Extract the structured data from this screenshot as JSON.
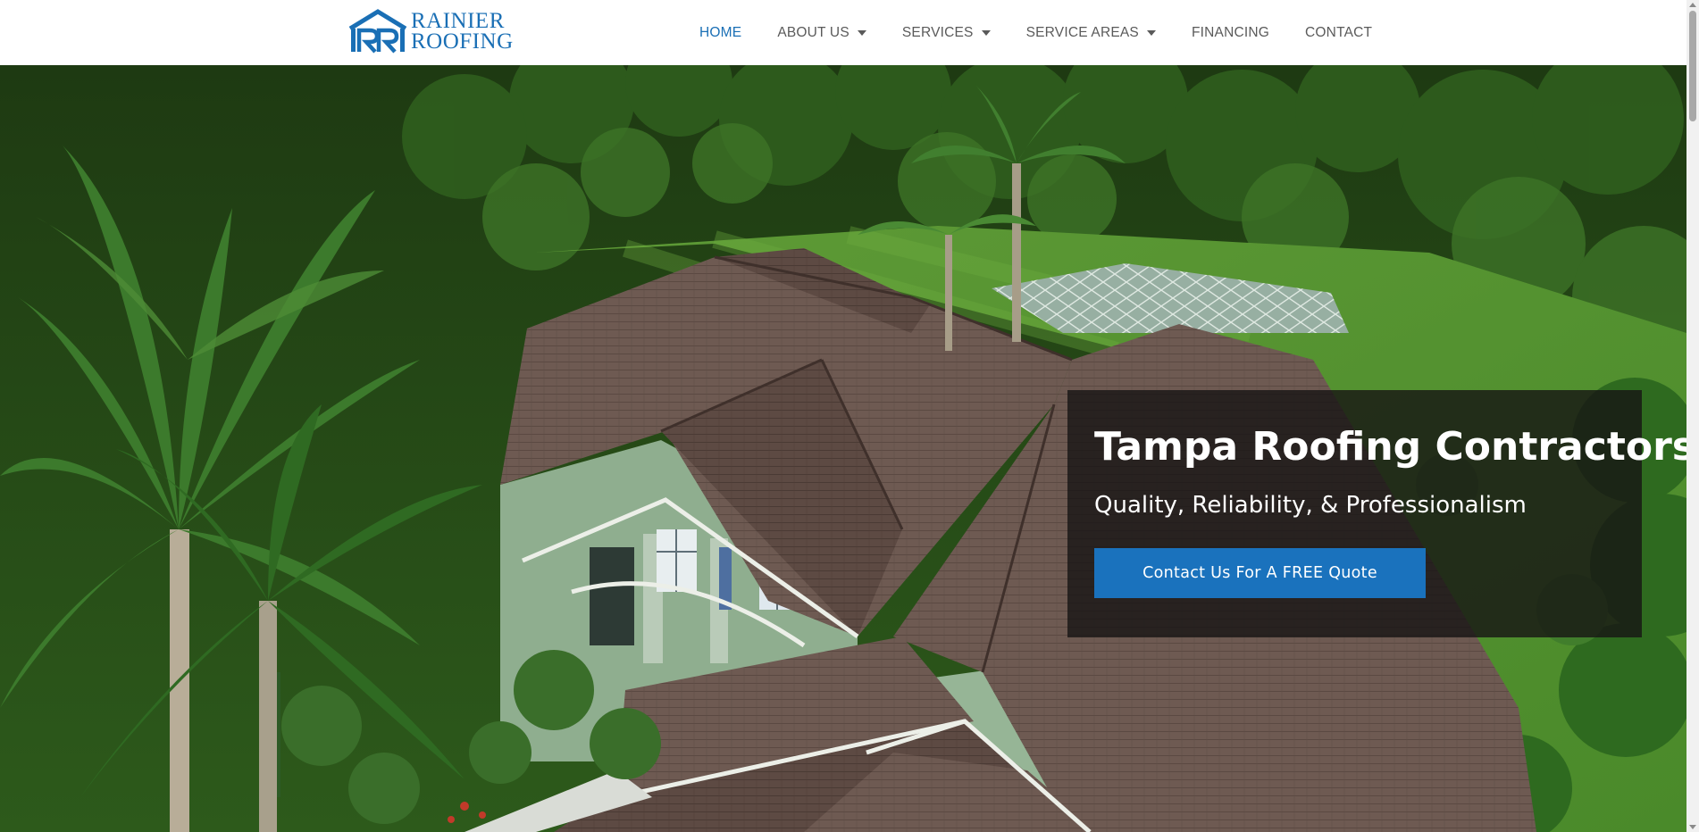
{
  "brand": {
    "logo_line1": "RAINIER",
    "logo_line2": "ROOFING",
    "logo_color": "#1a6fb5"
  },
  "nav": {
    "items": [
      {
        "label": "HOME",
        "active": true,
        "has_dropdown": false
      },
      {
        "label": "ABOUT US",
        "active": false,
        "has_dropdown": true
      },
      {
        "label": "SERVICES",
        "active": false,
        "has_dropdown": true
      },
      {
        "label": "SERVICE AREAS",
        "active": false,
        "has_dropdown": true
      },
      {
        "label": "FINANCING",
        "active": false,
        "has_dropdown": false
      },
      {
        "label": "CONTACT",
        "active": false,
        "has_dropdown": false
      }
    ],
    "active_color": "#1a6fb5",
    "text_color": "#5a5a5a"
  },
  "hero": {
    "background_image": "aerial-house-roof-photo",
    "title": "Tampa Roofing Contractors",
    "subtitle": "Quality, Reliability, & Professionalism",
    "cta_label": "Contact Us For A FREE Quote",
    "cta_color": "#1a72bd"
  }
}
